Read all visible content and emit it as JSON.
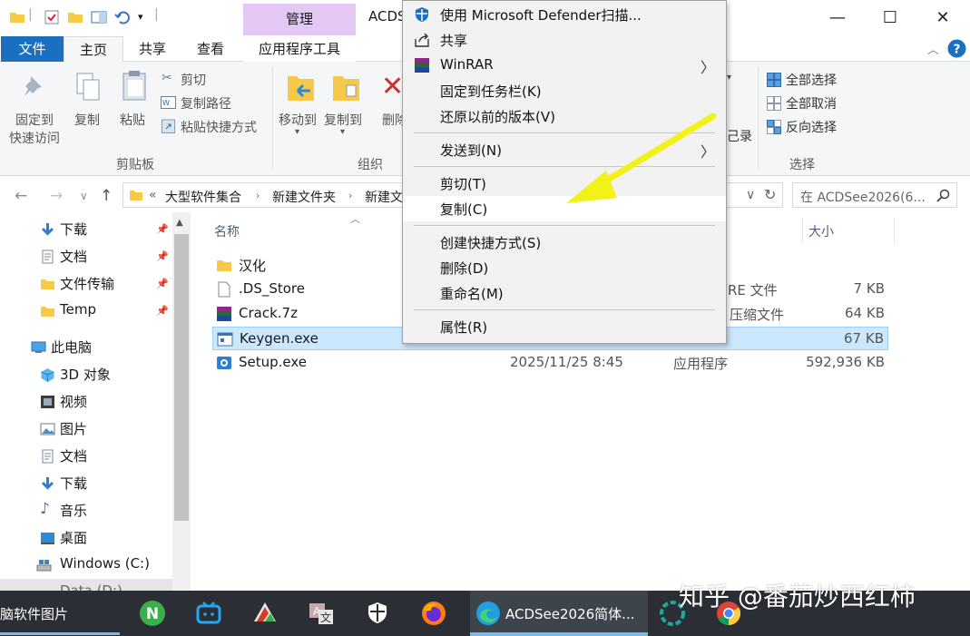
{
  "titlebar": {
    "manage_tab": "管理",
    "app_title": "ACDS",
    "minimize": "—",
    "maximize": "☐",
    "close": "✕"
  },
  "ribbon_tabs": {
    "file": "文件",
    "home": "主页",
    "share": "共享",
    "view": "查看",
    "app_tools": "应用程序工具"
  },
  "ribbon": {
    "pin_quick_access": [
      "固定到",
      "快速访问"
    ],
    "copy": "复制",
    "paste": "粘贴",
    "cut": "剪切",
    "copy_path": "复制路径",
    "paste_shortcut": "粘贴快捷方式",
    "clipboard_group": "剪贴板",
    "move_to": "移动到",
    "copy_to": "复制到",
    "delete": "删除",
    "organize_group": "组织",
    "history_partial": "己录",
    "select_all": "全部选择",
    "select_none": "全部取消",
    "invert_selection": "反向选择",
    "select_group": "选择"
  },
  "address": {
    "overflow": "«",
    "crumbs": [
      "大型软件集合",
      "新建文件夹",
      "新建文"
    ],
    "search_placeholder": "在 ACDSee2026(6..."
  },
  "navpane": {
    "quick_access": [
      {
        "label": "下载",
        "pinned": true
      },
      {
        "label": "文档",
        "pinned": true
      },
      {
        "label": "文件传输",
        "pinned": true
      },
      {
        "label": "Temp",
        "pinned": true
      }
    ],
    "this_pc": "此电脑",
    "pc_items": [
      "3D 对象",
      "视频",
      "图片",
      "文档",
      "下载",
      "音乐",
      "桌面",
      "Windows (C:)",
      "Data (D:)"
    ]
  },
  "filelist": {
    "col_name": "名称",
    "col_size": "大小",
    "files": [
      {
        "name": "汉化",
        "date": "",
        "type": "",
        "size": "",
        "icon": "folder-icon"
      },
      {
        "name": ".DS_Store",
        "date": "",
        "type": "RE 文件",
        "size": "7 KB",
        "icon": "file-icon"
      },
      {
        "name": "Crack.7z",
        "date": "",
        "type": "压缩文件",
        "size": "64 KB",
        "icon": "winrar-icon"
      },
      {
        "name": "Keygen.exe",
        "date": "",
        "type": "",
        "size": "67 KB",
        "icon": "exe-icon",
        "selected": true
      },
      {
        "name": "Setup.exe",
        "date": "2025/11/25 8:45",
        "type": "应用程序",
        "size": "592,936 KB",
        "icon": "setup-icon"
      }
    ]
  },
  "context_menu": {
    "defender": "使用 Microsoft Defender扫描...",
    "share": "共享",
    "winrar": "WinRAR",
    "pin_taskbar": "固定到任务栏(K)",
    "restore": "还原以前的版本(V)",
    "send_to": "发送到(N)",
    "cut": "剪切(T)",
    "copy": "复制(C)",
    "create_shortcut": "创建快捷方式(S)",
    "delete": "删除(D)",
    "rename": "重命名(M)",
    "properties": "属性(R)"
  },
  "taskbar": {
    "left_label": "脑软件图片",
    "acdsee_label": "ACDSee2026简体..."
  },
  "watermark": "知乎 @番茄炒西红柿",
  "colors": {
    "accent": "#1b6fc1",
    "manage_tab": "#e4c8f4",
    "selection": "#cce8ff",
    "arrow": "#f2f21a",
    "taskbar": "#2b2f35"
  }
}
